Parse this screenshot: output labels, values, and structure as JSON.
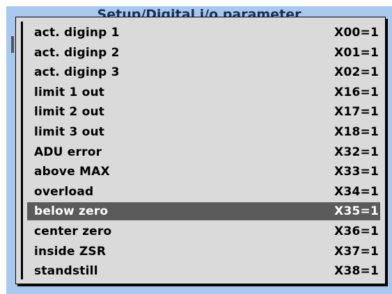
{
  "window": {
    "title": "Setup/Digital i/o parameter"
  },
  "menu": {
    "items": [
      {
        "label": "act. diginp 1",
        "value": "X00=1"
      },
      {
        "label": "act. diginp 2",
        "value": "X01=1"
      },
      {
        "label": "act. diginp 3",
        "value": "X02=1"
      },
      {
        "label": "limit 1 out",
        "value": "X16=1"
      },
      {
        "label": "limit 2 out",
        "value": "X17=1"
      },
      {
        "label": "limit 3 out",
        "value": "X18=1"
      },
      {
        "label": "ADU error",
        "value": "X32=1"
      },
      {
        "label": "above MAX",
        "value": "X33=1"
      },
      {
        "label": "overload",
        "value": "X34=1"
      },
      {
        "label": "below zero",
        "value": "X35=1"
      },
      {
        "label": "center zero",
        "value": "X36=1"
      },
      {
        "label": "inside ZSR",
        "value": "X37=1"
      },
      {
        "label": "standstill",
        "value": "X38=1"
      }
    ],
    "selected_index": 9
  },
  "colors": {
    "window_background": "#a9c8f0",
    "menu_background": "#dadada",
    "selected_background": "#5b5b5b",
    "selected_text": "#ffffff"
  }
}
